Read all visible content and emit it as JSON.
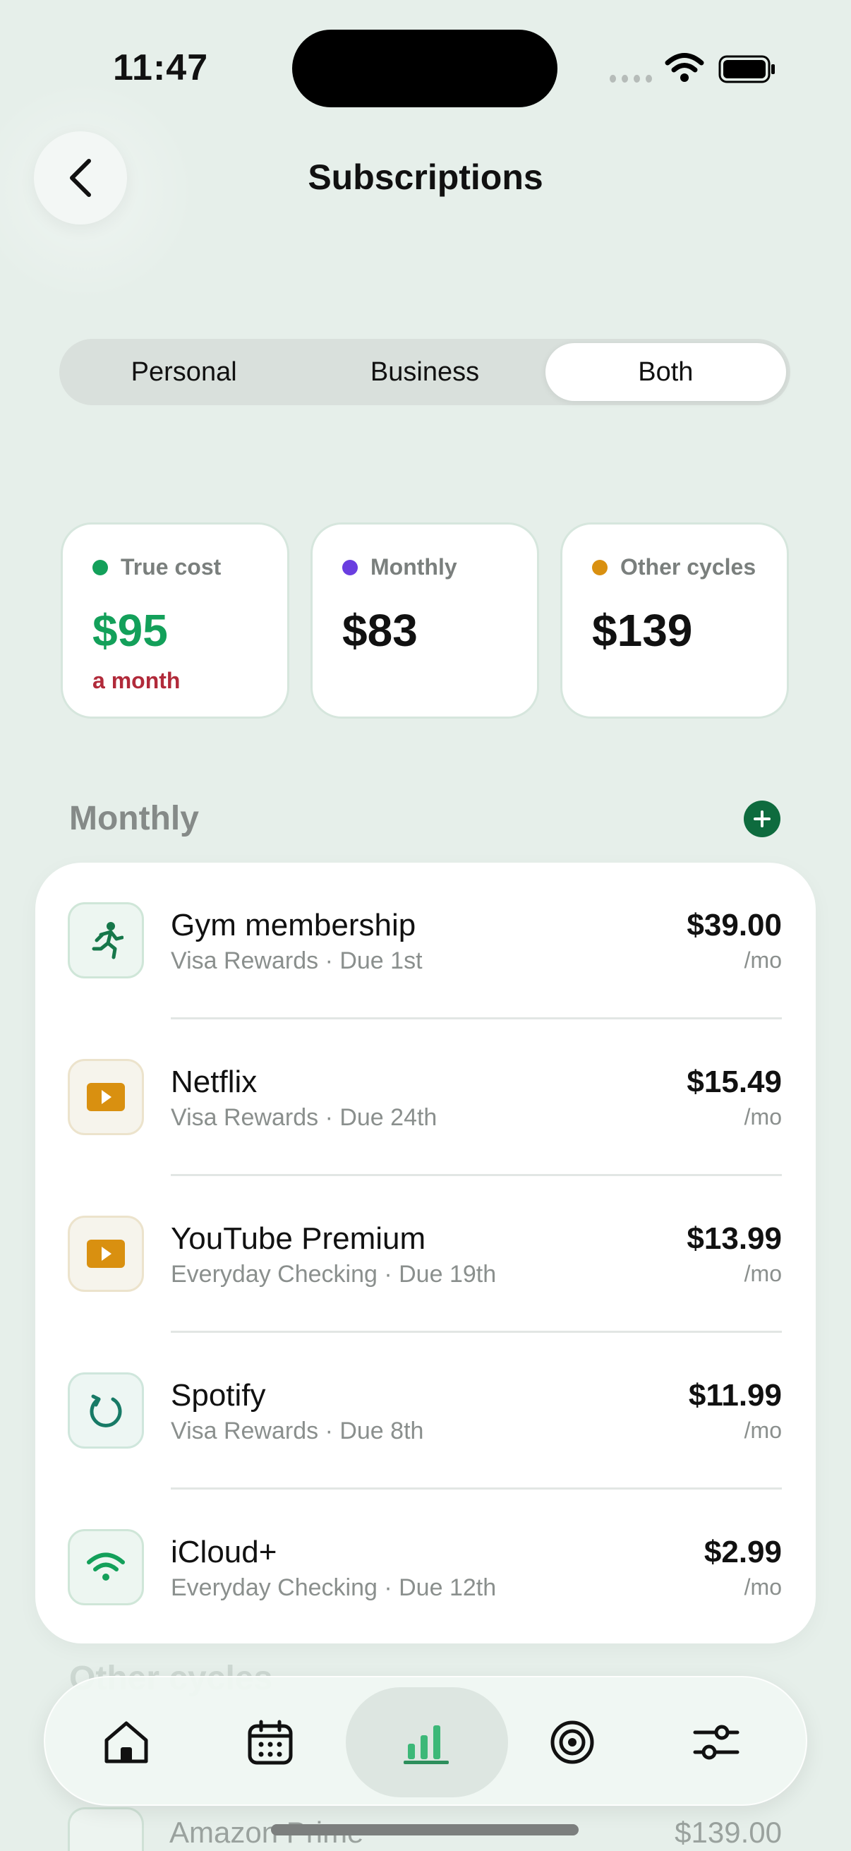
{
  "status": {
    "time": "11:47"
  },
  "header": {
    "title": "Subscriptions",
    "back_icon": "chevron-left-icon"
  },
  "segmented": {
    "options": [
      "Personal",
      "Business",
      "Both"
    ],
    "selected": "Both"
  },
  "stats": [
    {
      "label": "True cost",
      "value": "$95",
      "sub": "a month",
      "dot_color": "#13a05a",
      "value_color": "#13a05a"
    },
    {
      "label": "Monthly",
      "value": "$83",
      "dot_color": "#6a3ee0"
    },
    {
      "label": "Other cycles",
      "value": "$139",
      "dot_color": "#d99010"
    }
  ],
  "section": {
    "title": "Monthly"
  },
  "subscriptions": [
    {
      "name": "Gym membership",
      "detail": "Visa Rewards · Due 1st",
      "amount": "$39.00",
      "period": "/mo",
      "icon": "running-icon"
    },
    {
      "name": "Netflix",
      "detail": "Visa Rewards · Due 24th",
      "amount": "$15.49",
      "period": "/mo",
      "icon": "play-icon"
    },
    {
      "name": "YouTube Premium",
      "detail": "Everyday Checking · Due 19th",
      "amount": "$13.99",
      "period": "/mo",
      "icon": "play-icon"
    },
    {
      "name": "Spotify",
      "detail": "Visa Rewards · Due 8th",
      "amount": "$11.99",
      "period": "/mo",
      "icon": "refresh-icon"
    },
    {
      "name": "iCloud+",
      "detail": "Everyday Checking · Due 12th",
      "amount": "$2.99",
      "period": "/mo",
      "icon": "wifi-icon"
    }
  ],
  "peek": {
    "section_label": "Other cycles",
    "item_name": "Amazon Prime",
    "item_amount": "$139.00"
  },
  "tabs": [
    {
      "name": "home",
      "icon": "home-icon"
    },
    {
      "name": "calendar",
      "icon": "calendar-icon"
    },
    {
      "name": "insights",
      "icon": "bar-chart-icon",
      "active": true
    },
    {
      "name": "goals",
      "icon": "target-icon"
    },
    {
      "name": "settings",
      "icon": "sliders-icon"
    }
  ],
  "colors": {
    "accent": "#13a05a",
    "warning": "#b12a3a",
    "play": "#d99010",
    "background": "#e6efea"
  }
}
